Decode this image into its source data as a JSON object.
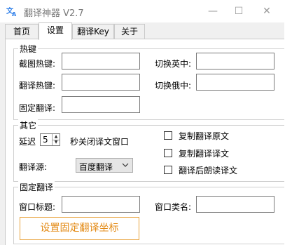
{
  "window": {
    "title": "翻译神器 V2.7",
    "app_icon_glyph": "文A",
    "minimize_label": "—",
    "maximize_label": "☐",
    "close_label": "✕"
  },
  "tabs": [
    {
      "label": "首页"
    },
    {
      "label": "设置"
    },
    {
      "label": "翻译Key"
    },
    {
      "label": "关于"
    }
  ],
  "hotkeys": {
    "group_title": "热键",
    "screenshot_label": "截图热键:",
    "screenshot_value": "",
    "translate_label": "翻译热键:",
    "translate_value": "",
    "fixed_label": "固定翻译:",
    "fixed_value": "",
    "switch_zh_en_label": "切换英中:",
    "switch_zh_en_value": "",
    "switch_ru_zh_label": "切换俄中:",
    "switch_ru_zh_value": ""
  },
  "other": {
    "group_title": "其它",
    "delay_label": "延迟",
    "delay_value": "5",
    "delay_suffix": "秒关闭译文窗口",
    "source_label": "翻译源:",
    "source_value": "百度翻译",
    "copy_source_label": "复制翻译原文",
    "copy_source_checked": false,
    "copy_target_label": "复制翻译译文",
    "copy_target_checked": false,
    "read_aloud_label": "翻译后朗读译文",
    "read_aloud_checked": false
  },
  "fixed": {
    "group_title": "固定翻译",
    "window_title_label": "窗口标题:",
    "window_title_value": "",
    "window_class_label": "窗口类名:",
    "window_class_value": "",
    "set_coords_button": "设置固定翻译坐标"
  },
  "colors": {
    "accent_orange": "#e38a14",
    "app_icon_blue": "#2b7de9"
  }
}
